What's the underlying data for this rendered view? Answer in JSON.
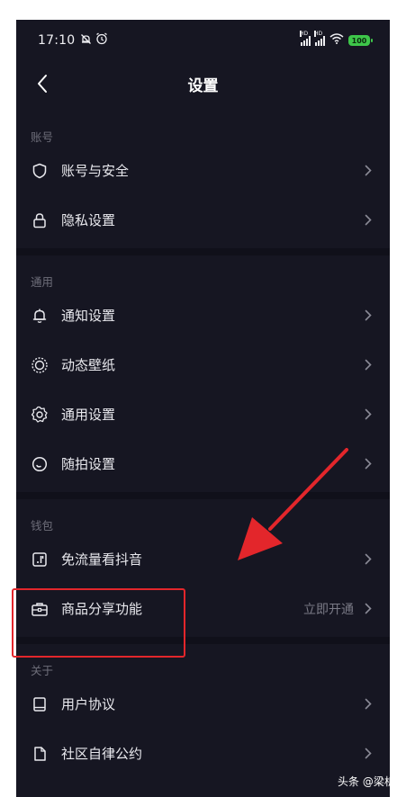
{
  "status_bar": {
    "time": "17:10",
    "left_icons": [
      "mute-icon",
      "alarm-icon"
    ],
    "signal_tag": "HD",
    "battery": "100"
  },
  "header": {
    "title": "设置",
    "back_icon": "chevron-left-icon"
  },
  "sections": [
    {
      "title": "账号",
      "items": [
        {
          "label": "账号与安全",
          "icon": "shield-icon"
        },
        {
          "label": "隐私设置",
          "icon": "lock-icon"
        }
      ]
    },
    {
      "title": "通用",
      "items": [
        {
          "label": "通知设置",
          "icon": "bell-icon"
        },
        {
          "label": "动态壁纸",
          "icon": "wallpaper-icon"
        },
        {
          "label": "通用设置",
          "icon": "gear-icon"
        },
        {
          "label": "随拍设置",
          "icon": "snap-icon"
        }
      ]
    },
    {
      "title": "钱包",
      "items": [
        {
          "label": "免流量看抖音",
          "icon": "data-card-icon"
        },
        {
          "label": "商品分享功能",
          "icon": "briefcase-icon",
          "value": "立即开通"
        }
      ]
    },
    {
      "title": "关于",
      "items": [
        {
          "label": "用户协议",
          "icon": "book-icon"
        },
        {
          "label": "社区自律公约",
          "icon": "document-icon"
        }
      ]
    }
  ],
  "colors": {
    "background": "#161622",
    "annotation": "#e3262b",
    "battery": "#3ec64a"
  },
  "watermark": "头条 @梁析说"
}
